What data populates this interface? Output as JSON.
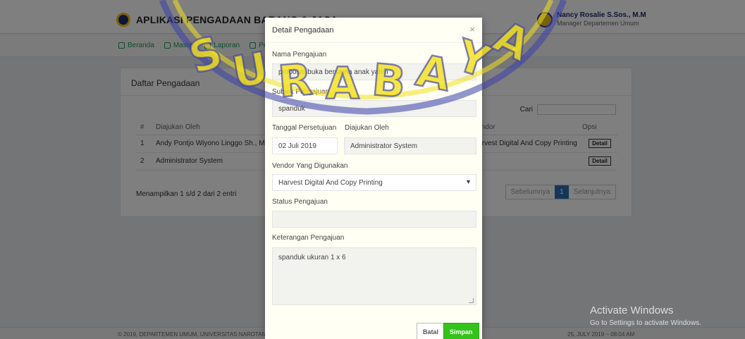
{
  "app": {
    "title": "APLIKASI PENGADAAN BARANG & JASA",
    "user_name": "Nancy Rosalie S.Sos., M.M",
    "user_role": "Manager Departemen Umum"
  },
  "nav": [
    "Beranda",
    "Master",
    "Laporan",
    "Pengajuan"
  ],
  "list": {
    "title": "Daftar Pengadaan",
    "search_label": "Cari",
    "columns": [
      "#",
      "Diajukan Oleh",
      "Vendor",
      "Opsi"
    ],
    "rows": [
      {
        "num": "1",
        "by": "Andy Pontjo Wiyono Linggo Sh., M.",
        "vendor": "Harvest Digital And Copy Printing",
        "action": "Detail"
      },
      {
        "num": "2",
        "by": "Administrator System",
        "vendor": "-",
        "action": "Detail"
      }
    ],
    "info": "Menampilkan 1 s/d 2 dari 2 entri",
    "pager": {
      "prev": "Sebelumnya",
      "current": "1",
      "next": "Selanjutnya"
    }
  },
  "footer": {
    "left": "© 2019, DEPARTEMEN UMUM, UNIVERSITAS NAROTAMA",
    "right": "25, JULY 2019 ~ 08:04 AM"
  },
  "watermark": "SURABAYA",
  "modal": {
    "title": "Detail Pengadaan",
    "close": "×",
    "nama_label": "Nama Pengajuan",
    "nama_value": "proposal buka bersama anak yatim",
    "subjek_label": "Subjek Pengajuan",
    "subjek_value": "spanduk",
    "tanggal_label": "Tanggal Persetujuan",
    "tanggal_value": "02 Juli 2019",
    "diajukan_label": "Diajukan Oleh",
    "diajukan_value": "Administrator System",
    "vendor_label": "Vendor Yang Digunakan",
    "vendor_value": "Harvest Digital And Copy Printing",
    "status_label": "Status Pengajuan",
    "status_value": "",
    "keterangan_label": "Keterangan Pengajuan",
    "keterangan_value": "spanduk ukuran 1 x 6",
    "batal": "Batal",
    "simpan": "Simpan"
  },
  "activate": {
    "line1": "Activate Windows",
    "line2": "Go to Settings to activate Windows."
  }
}
